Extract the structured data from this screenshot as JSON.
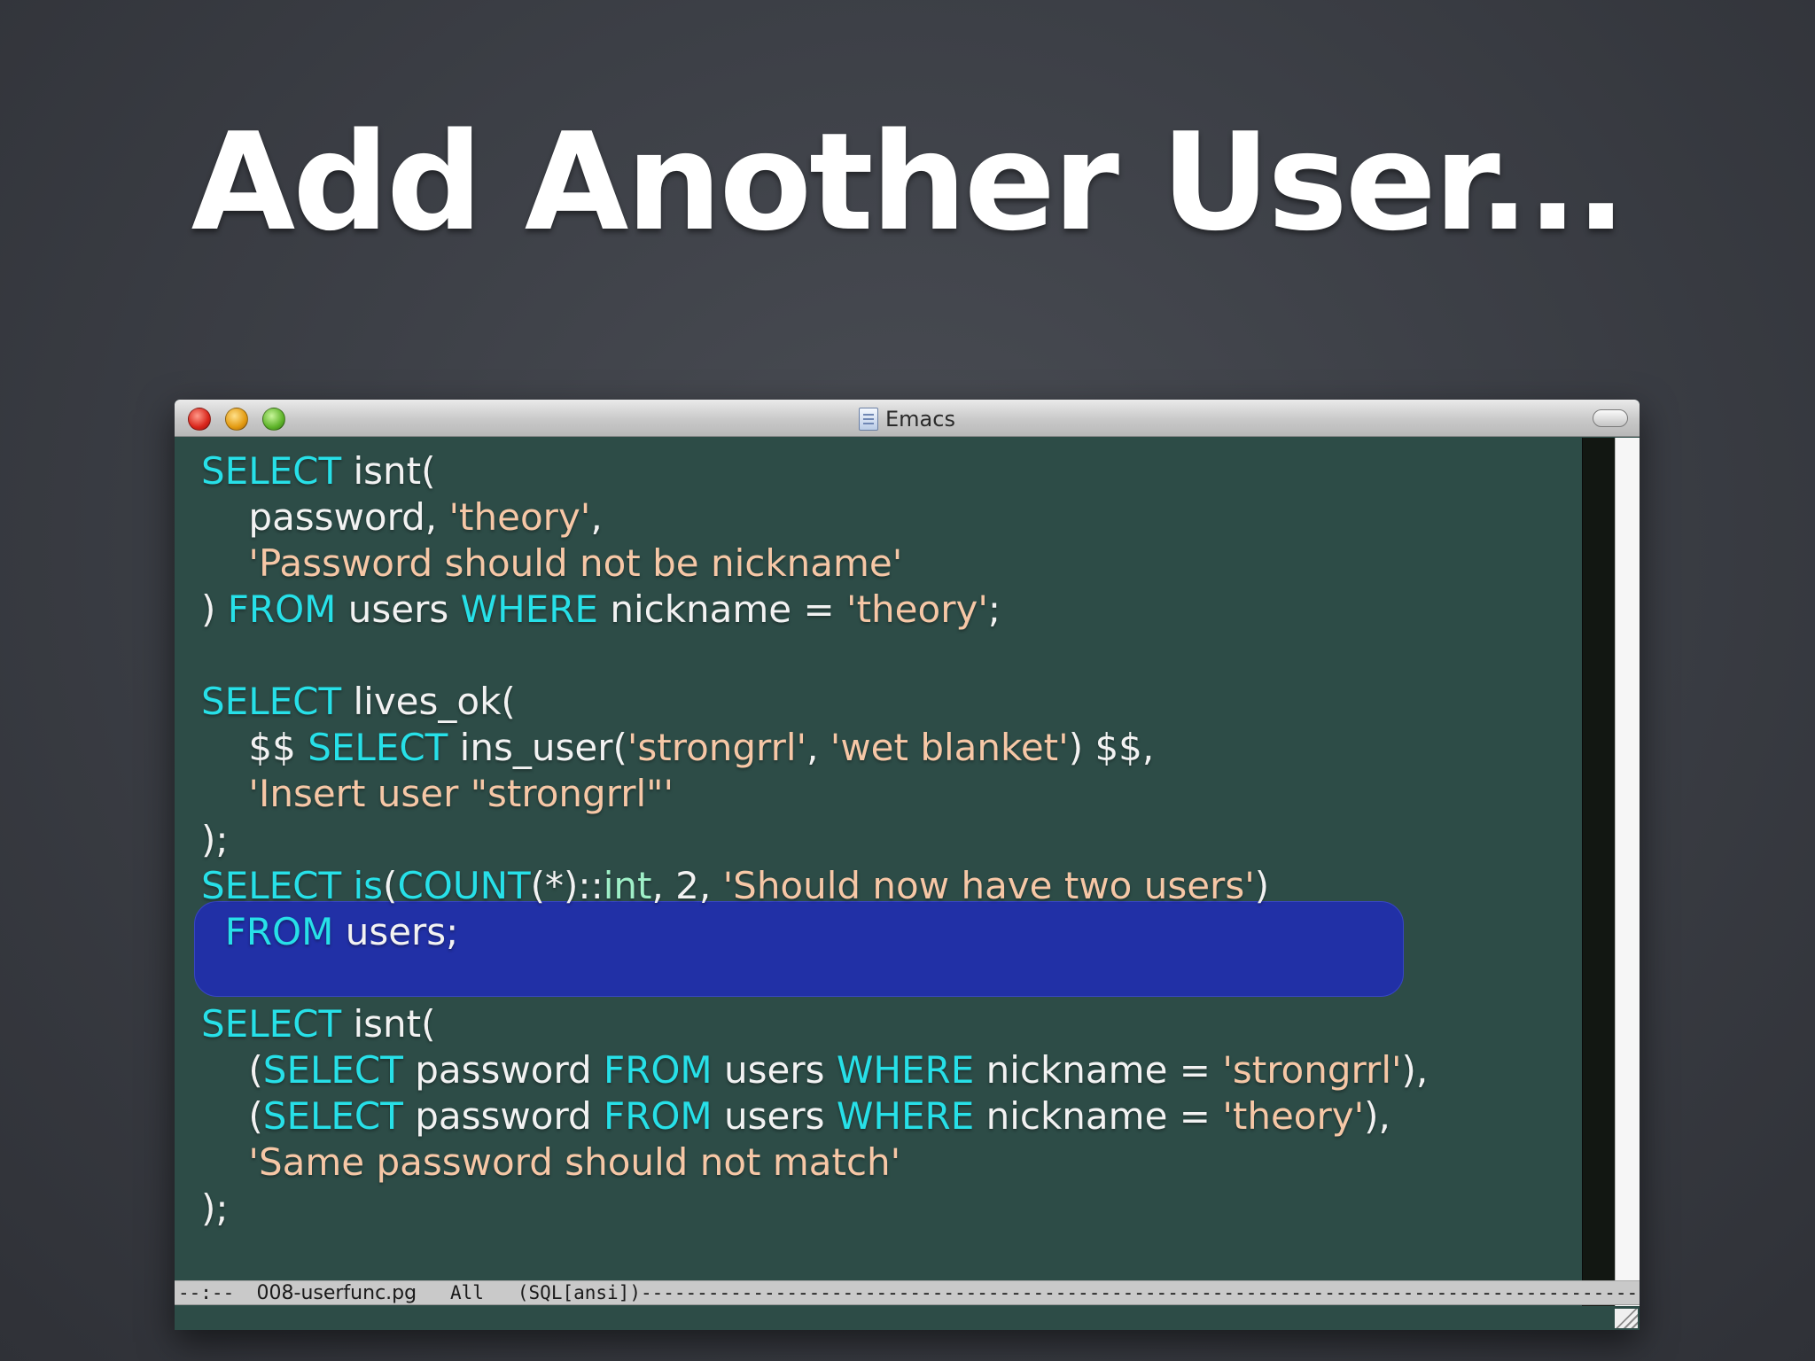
{
  "slide": {
    "title": "Add Another User..."
  },
  "window": {
    "title": "Emacs",
    "icons": [
      "close-button",
      "minimize-button",
      "zoom-button",
      "document-icon",
      "toolbar-toggle-button"
    ]
  },
  "code": {
    "lines": [
      [
        {
          "t": "SELECT",
          "c": "kw"
        },
        {
          "t": " isnt(",
          "c": ""
        }
      ],
      [
        {
          "t": "    password, ",
          "c": ""
        },
        {
          "t": "'theory'",
          "c": "str"
        },
        {
          "t": ",",
          "c": ""
        }
      ],
      [
        {
          "t": "    ",
          "c": ""
        },
        {
          "t": "'Password should not be nickname'",
          "c": "str"
        }
      ],
      [
        {
          "t": ") ",
          "c": ""
        },
        {
          "t": "FROM",
          "c": "kw"
        },
        {
          "t": " users ",
          "c": ""
        },
        {
          "t": "WHERE",
          "c": "kw"
        },
        {
          "t": " nickname = ",
          "c": ""
        },
        {
          "t": "'theory'",
          "c": "str"
        },
        {
          "t": ";",
          "c": ""
        }
      ],
      [],
      [
        {
          "t": "SELECT",
          "c": "kw"
        },
        {
          "t": " lives_ok(",
          "c": ""
        }
      ],
      [
        {
          "t": "    $$ ",
          "c": ""
        },
        {
          "t": "SELECT",
          "c": "kw"
        },
        {
          "t": " ins_user(",
          "c": ""
        },
        {
          "t": "'strongrrl'",
          "c": "str"
        },
        {
          "t": ", ",
          "c": ""
        },
        {
          "t": "'wet blanket'",
          "c": "str"
        },
        {
          "t": ") $$,",
          "c": ""
        }
      ],
      [
        {
          "t": "    ",
          "c": ""
        },
        {
          "t": "'Insert user \"strongrrl\"'",
          "c": "str"
        }
      ],
      [
        {
          "t": ");",
          "c": ""
        }
      ],
      [
        {
          "t": "SELECT",
          "c": "kw"
        },
        {
          "t": " ",
          "c": ""
        },
        {
          "t": "is",
          "c": "kw"
        },
        {
          "t": "(",
          "c": ""
        },
        {
          "t": "COUNT",
          "c": "kw"
        },
        {
          "t": "(*)::",
          "c": ""
        },
        {
          "t": "int",
          "c": "ty"
        },
        {
          "t": ", 2, ",
          "c": ""
        },
        {
          "t": "'Should now have two users'",
          "c": "str"
        },
        {
          "t": ")",
          "c": ""
        }
      ],
      [
        {
          "t": "  ",
          "c": ""
        },
        {
          "t": "FROM",
          "c": "kw"
        },
        {
          "t": " users;",
          "c": ""
        }
      ],
      [],
      [
        {
          "t": "SELECT",
          "c": "kw"
        },
        {
          "t": " isnt(",
          "c": ""
        }
      ],
      [
        {
          "t": "    (",
          "c": ""
        },
        {
          "t": "SELECT",
          "c": "kw"
        },
        {
          "t": " password ",
          "c": ""
        },
        {
          "t": "FROM",
          "c": "kw"
        },
        {
          "t": " users ",
          "c": ""
        },
        {
          "t": "WHERE",
          "c": "kw"
        },
        {
          "t": " nickname = ",
          "c": ""
        },
        {
          "t": "'strongrrl'",
          "c": "str"
        },
        {
          "t": "),",
          "c": ""
        }
      ],
      [
        {
          "t": "    (",
          "c": ""
        },
        {
          "t": "SELECT",
          "c": "kw"
        },
        {
          "t": " password ",
          "c": ""
        },
        {
          "t": "FROM",
          "c": "kw"
        },
        {
          "t": " users ",
          "c": ""
        },
        {
          "t": "WHERE",
          "c": "kw"
        },
        {
          "t": " nickname = ",
          "c": ""
        },
        {
          "t": "'theory'",
          "c": "str"
        },
        {
          "t": "),",
          "c": ""
        }
      ],
      [
        {
          "t": "    ",
          "c": ""
        },
        {
          "t": "'Same password should not match'",
          "c": "str"
        }
      ],
      [
        {
          "t": ");",
          "c": ""
        }
      ]
    ],
    "highlighted_lines": [
      9,
      10
    ]
  },
  "modeline": {
    "prefix": "--:--  ",
    "filename": "008-userfunc.pg",
    "position": "   All   ",
    "mode": "(SQL[ansi])",
    "fill": "----------------------------------------------------------------------------------------------------------------------------"
  },
  "colors": {
    "keyword": "#27e0e8",
    "string": "#f6c7a6",
    "type": "#9ff0c8",
    "text": "#f2f2f2",
    "editor_bg": "#2d4c47",
    "highlight": "#2130a6"
  }
}
